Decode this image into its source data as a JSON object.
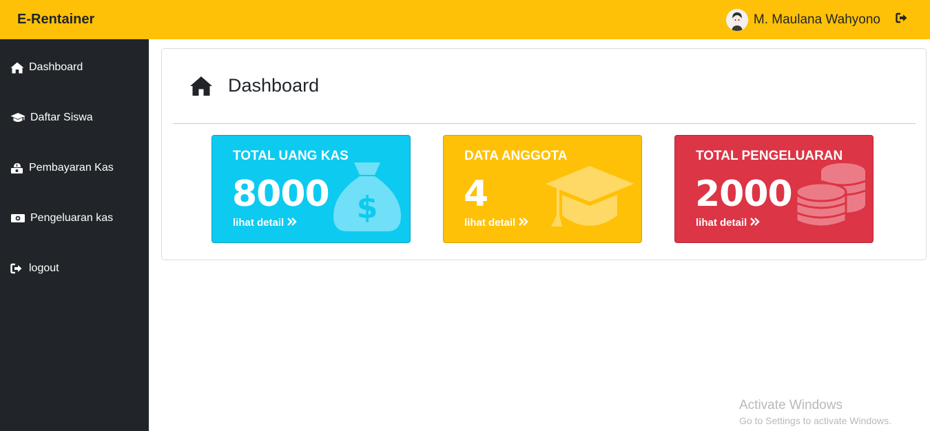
{
  "header": {
    "brand": "E-Rentainer",
    "user_name": "M. Maulana Wahyono"
  },
  "sidebar": {
    "items": [
      {
        "label": "Dashboard",
        "icon": "home-icon"
      },
      {
        "label": "Daftar Siswa",
        "icon": "graduation-cap-icon"
      },
      {
        "label": "Pembayaran Kas",
        "icon": "money-bag-icon"
      },
      {
        "label": "Pengeluaran kas",
        "icon": "money-bill-icon"
      },
      {
        "label": "logout",
        "icon": "sign-out-icon"
      }
    ]
  },
  "main": {
    "title": "Dashboard",
    "cards": [
      {
        "label": "TOTAL UANG KAS",
        "value": "8000",
        "detail": "lihat detail",
        "icon": "money-bag-icon",
        "color": "#0dcaf0"
      },
      {
        "label": "DATA ANGGOTA",
        "value": "4",
        "detail": "lihat detail",
        "icon": "graduation-cap-icon",
        "color": "#ffc107"
      },
      {
        "label": "TOTAL PENGELUARAN",
        "value": "2000",
        "detail": "lihat detail",
        "icon": "coins-icon",
        "color": "#dc3545"
      }
    ]
  },
  "watermark": {
    "line1": "Activate Windows",
    "line2": "Go to Settings to activate Windows."
  },
  "colors": {
    "topbar": "#ffc107",
    "sidebar": "#212529",
    "info": "#0dcaf0",
    "warning": "#ffc107",
    "danger": "#dc3545"
  }
}
